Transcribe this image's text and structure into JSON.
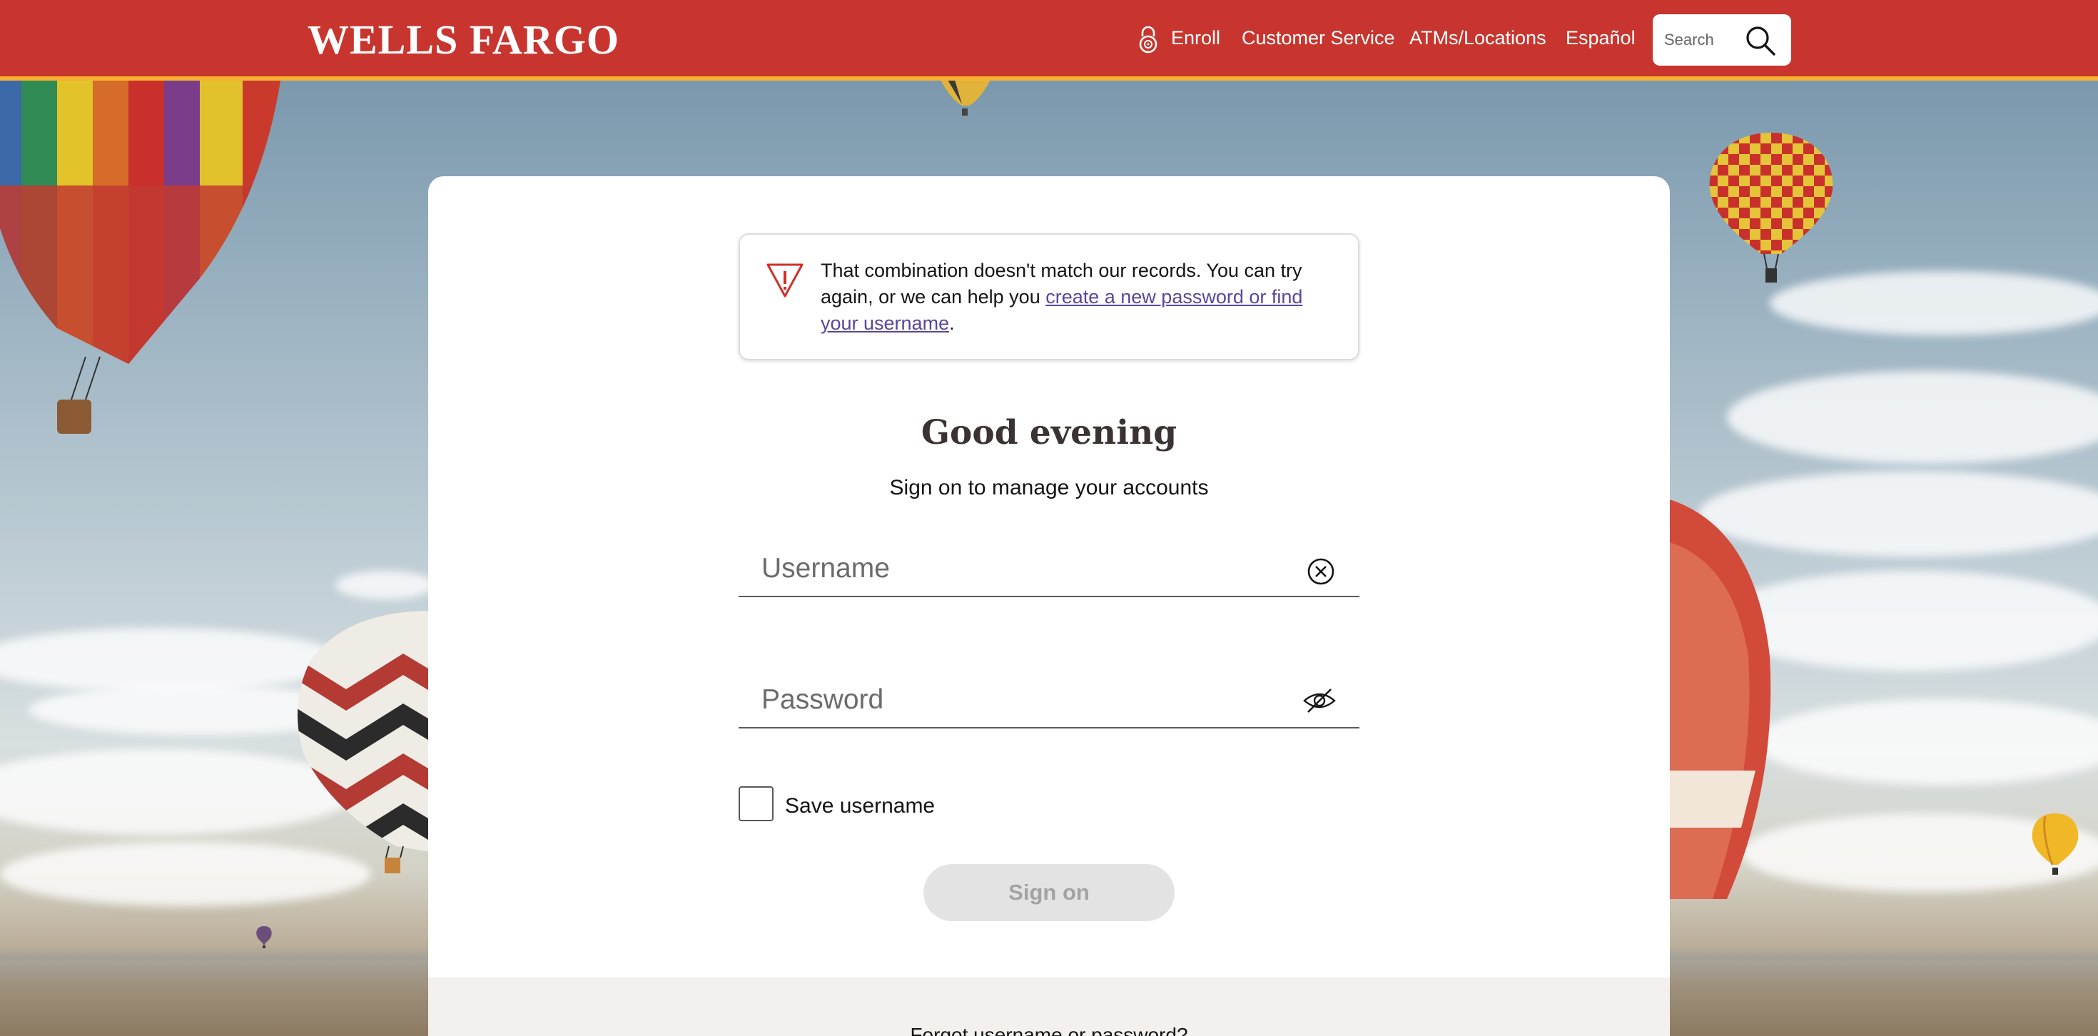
{
  "header": {
    "logo": "WELLS FARGO",
    "nav": {
      "enroll": "Enroll",
      "customer_service": "Customer Service",
      "atms": "ATMs/Locations",
      "espanol": "Español"
    },
    "search_placeholder": "Search"
  },
  "alert": {
    "text": "That combination doesn't match our records. You can try again, or we can help you ",
    "link": "create a new password or find your username",
    "suffix": "."
  },
  "signin": {
    "greeting": "Good evening",
    "subtitle": "Sign on to manage your accounts",
    "username_placeholder": "Username",
    "password_placeholder": "Password",
    "save_username": "Save username",
    "button": "Sign on",
    "forgot": "Forgot username or password?"
  },
  "colors": {
    "brand_red": "#c8352e",
    "accent_gold": "#f5b12f",
    "link_purple": "#5a469b"
  }
}
